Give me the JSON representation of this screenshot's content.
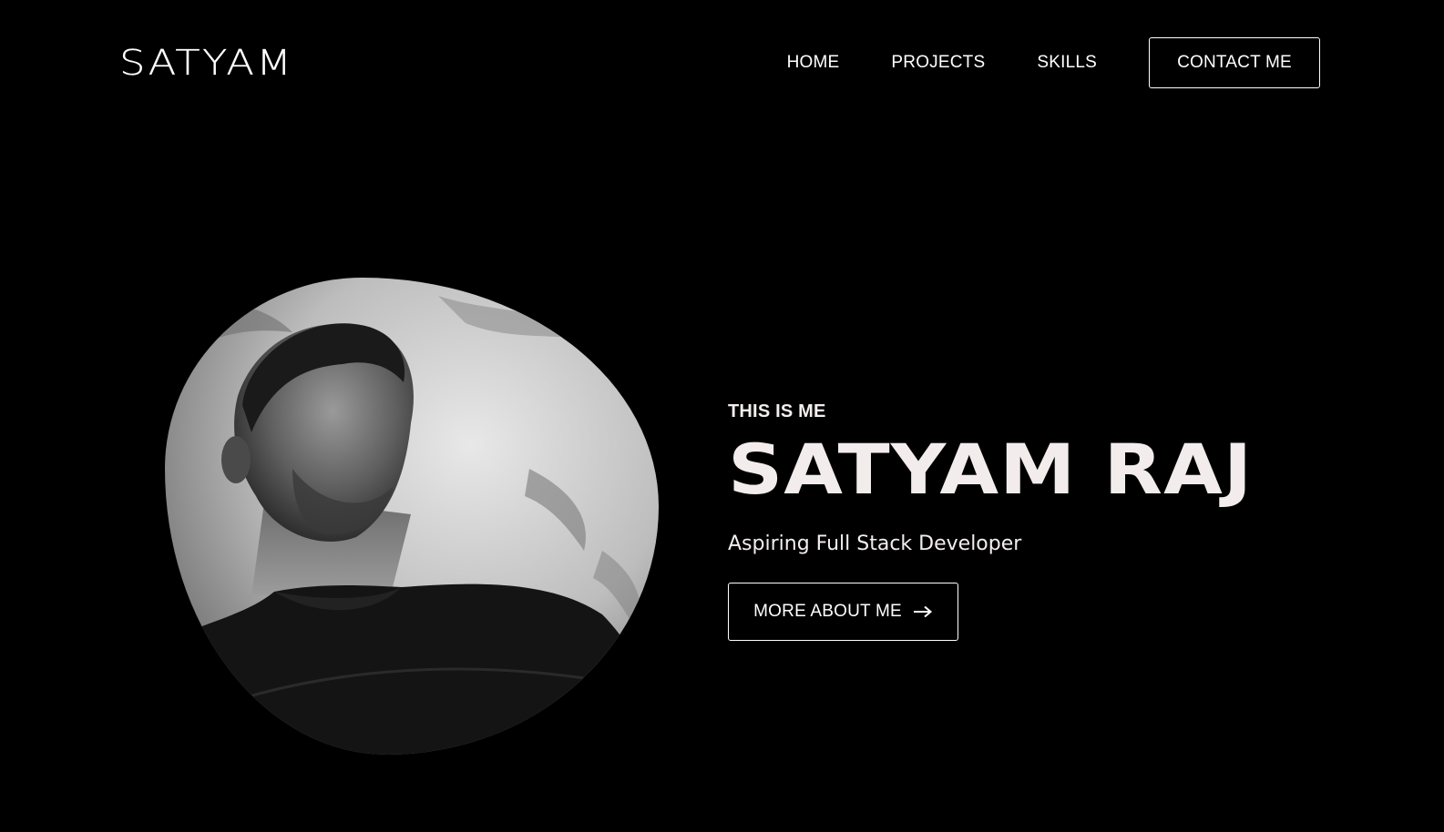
{
  "nav": {
    "logo": "SATYAM",
    "links": [
      "HOME",
      "PROJECTS",
      "SKILLS"
    ],
    "contact_label": "CONTACT ME"
  },
  "hero": {
    "eyebrow": "THIS IS ME",
    "name": "SATYAM RAJ",
    "tagline": "Aspiring Full Stack Developer",
    "button_label": "MORE ABOUT ME",
    "button_icon": "arrow-right-icon",
    "photo_alt": "portrait"
  },
  "colors": {
    "background": "#000000",
    "text": "#ffffff",
    "heading": "#f3ecec"
  }
}
